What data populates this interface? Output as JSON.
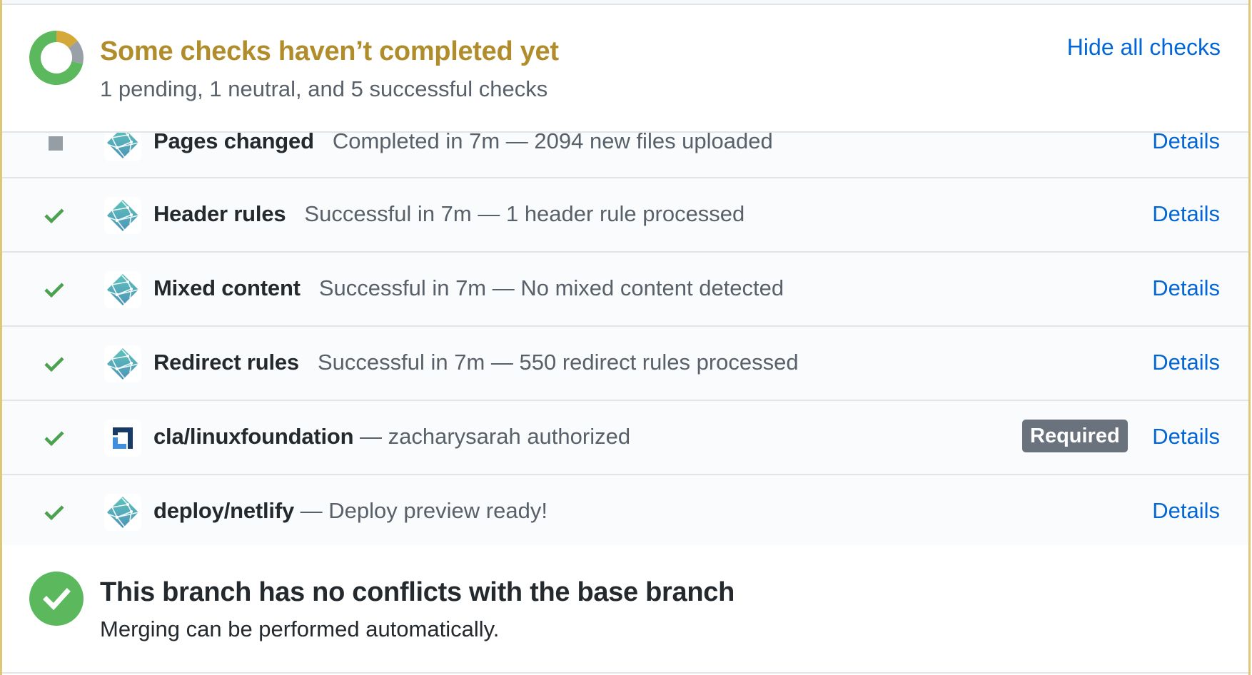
{
  "header": {
    "title": "Some checks haven’t completed yet",
    "subtitle": "1 pending, 1 neutral, and 5 successful checks",
    "toggle_label": "Hide all checks",
    "summary_counts": {
      "pending": 1,
      "neutral": 1,
      "successful": 5
    }
  },
  "colors": {
    "pending": "#d4a93a",
    "neutral": "#9aa0a8",
    "success": "#5cb85c",
    "link": "#0366d6",
    "title_pending": "#b08d2a"
  },
  "checks": [
    {
      "status": "neutral",
      "icon": "netlify-logo-icon",
      "name": "Pages changed",
      "separator": "",
      "description": "Completed in 7m — 2094 new files uploaded",
      "badge": "",
      "details_label": "Details"
    },
    {
      "status": "success",
      "icon": "netlify-logo-icon",
      "name": "Header rules",
      "separator": "",
      "description": "Successful in 7m — 1 header rule processed",
      "badge": "",
      "details_label": "Details"
    },
    {
      "status": "success",
      "icon": "netlify-logo-icon",
      "name": "Mixed content",
      "separator": "",
      "description": "Successful in 7m — No mixed content detected",
      "badge": "",
      "details_label": "Details"
    },
    {
      "status": "success",
      "icon": "netlify-logo-icon",
      "name": "Redirect rules",
      "separator": "",
      "description": "Successful in 7m — 550 redirect rules processed",
      "badge": "",
      "details_label": "Details"
    },
    {
      "status": "success",
      "icon": "linux-foundation-logo-icon",
      "name": "cla/linuxfoundation",
      "separator": " — ",
      "description": "zacharysarah authorized",
      "badge": "Required",
      "details_label": "Details"
    },
    {
      "status": "success",
      "icon": "netlify-logo-icon",
      "name": "deploy/netlify",
      "separator": " — ",
      "description": "Deploy preview ready!",
      "badge": "",
      "details_label": "Details"
    }
  ],
  "merge": {
    "title": "This branch has no conflicts with the base branch",
    "subtitle": "Merging can be performed automatically."
  }
}
